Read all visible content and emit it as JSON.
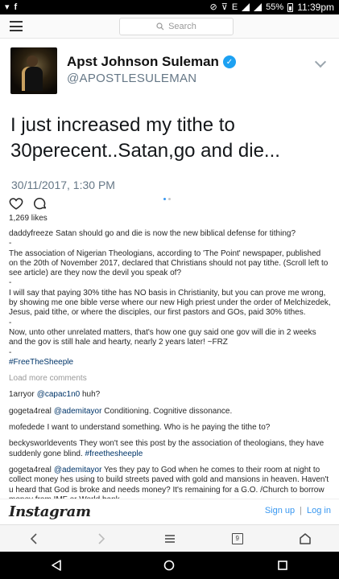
{
  "status_bar": {
    "time": "11:39pm",
    "battery": "55%",
    "network": "E"
  },
  "topbar": {
    "search_placeholder": "Search"
  },
  "tweet": {
    "name": "Apst Johnson Suleman",
    "handle": "@APOSTLESULEMAN",
    "text": "I just increased my tithe to 30perecent..Satan,go and die...",
    "timestamp": "30/11/2017, 1:30 PM"
  },
  "post": {
    "likes": "1,269 likes",
    "caption": {
      "username": "daddyfreeze",
      "lines": [
        "Satan should go and die is now the new biblical defense for tithing?",
        "-",
        "The association of Nigerian Theologians, according to 'The Point' newspaper, published on the 20th of November 2017, declared that Christians should not pay tithe. (Scroll left to see article) are they now the devil you speak of?",
        "-",
        "I will say that paying 30% tithe has NO basis in Christianity, but you can prove me wrong, by showing me one bible verse where our new High priest under the order of Melchizedek, Jesus, paid tithe, or where the disciples, our first pastors and GOs, paid 30% tithes.",
        "-",
        "Now, unto other unrelated matters, that's how one guy said one gov will die in 2 weeks and the gov is still hale and hearty, nearly 2 years later! ~FRZ",
        "-"
      ],
      "hashtag": "#FreeTheSheeple"
    },
    "load_more": "Load more comments",
    "comments": [
      {
        "user": "1arryor",
        "mention": "@capac1n0",
        "text": " huh?"
      },
      {
        "user": "gogeta4real",
        "mention": "@ademitayor",
        "text": " Conditioning. Cognitive dissonance."
      },
      {
        "user": "mofedede",
        "mention": "",
        "text": "I want to understand something. Who is he paying the tithe to?"
      },
      {
        "user": "beckysworldevents",
        "mention": "",
        "text": "They won't see this post by the association of theologians, they have suddenly gone blind. ",
        "tag": "#freethesheeple"
      },
      {
        "user": "gogeta4real",
        "mention": "@ademitayor",
        "text": " Yes they pay to God when he comes to their room at night to collect money hes using to build streets paved with gold and mansions in heaven. Haven't u heard that God is broke and needs money? It's remaining for a G.O. /Church to borrow money from IMF or World bank"
      }
    ]
  },
  "instagram_bar": {
    "logo": "Instagram",
    "signup": "Sign up",
    "login": "Log in",
    "separator": "|"
  },
  "browser_bar": {
    "tab_count": "9"
  },
  "colors": {
    "link": "#003569",
    "accent": "#3897f0",
    "verified": "#1da1f2"
  }
}
